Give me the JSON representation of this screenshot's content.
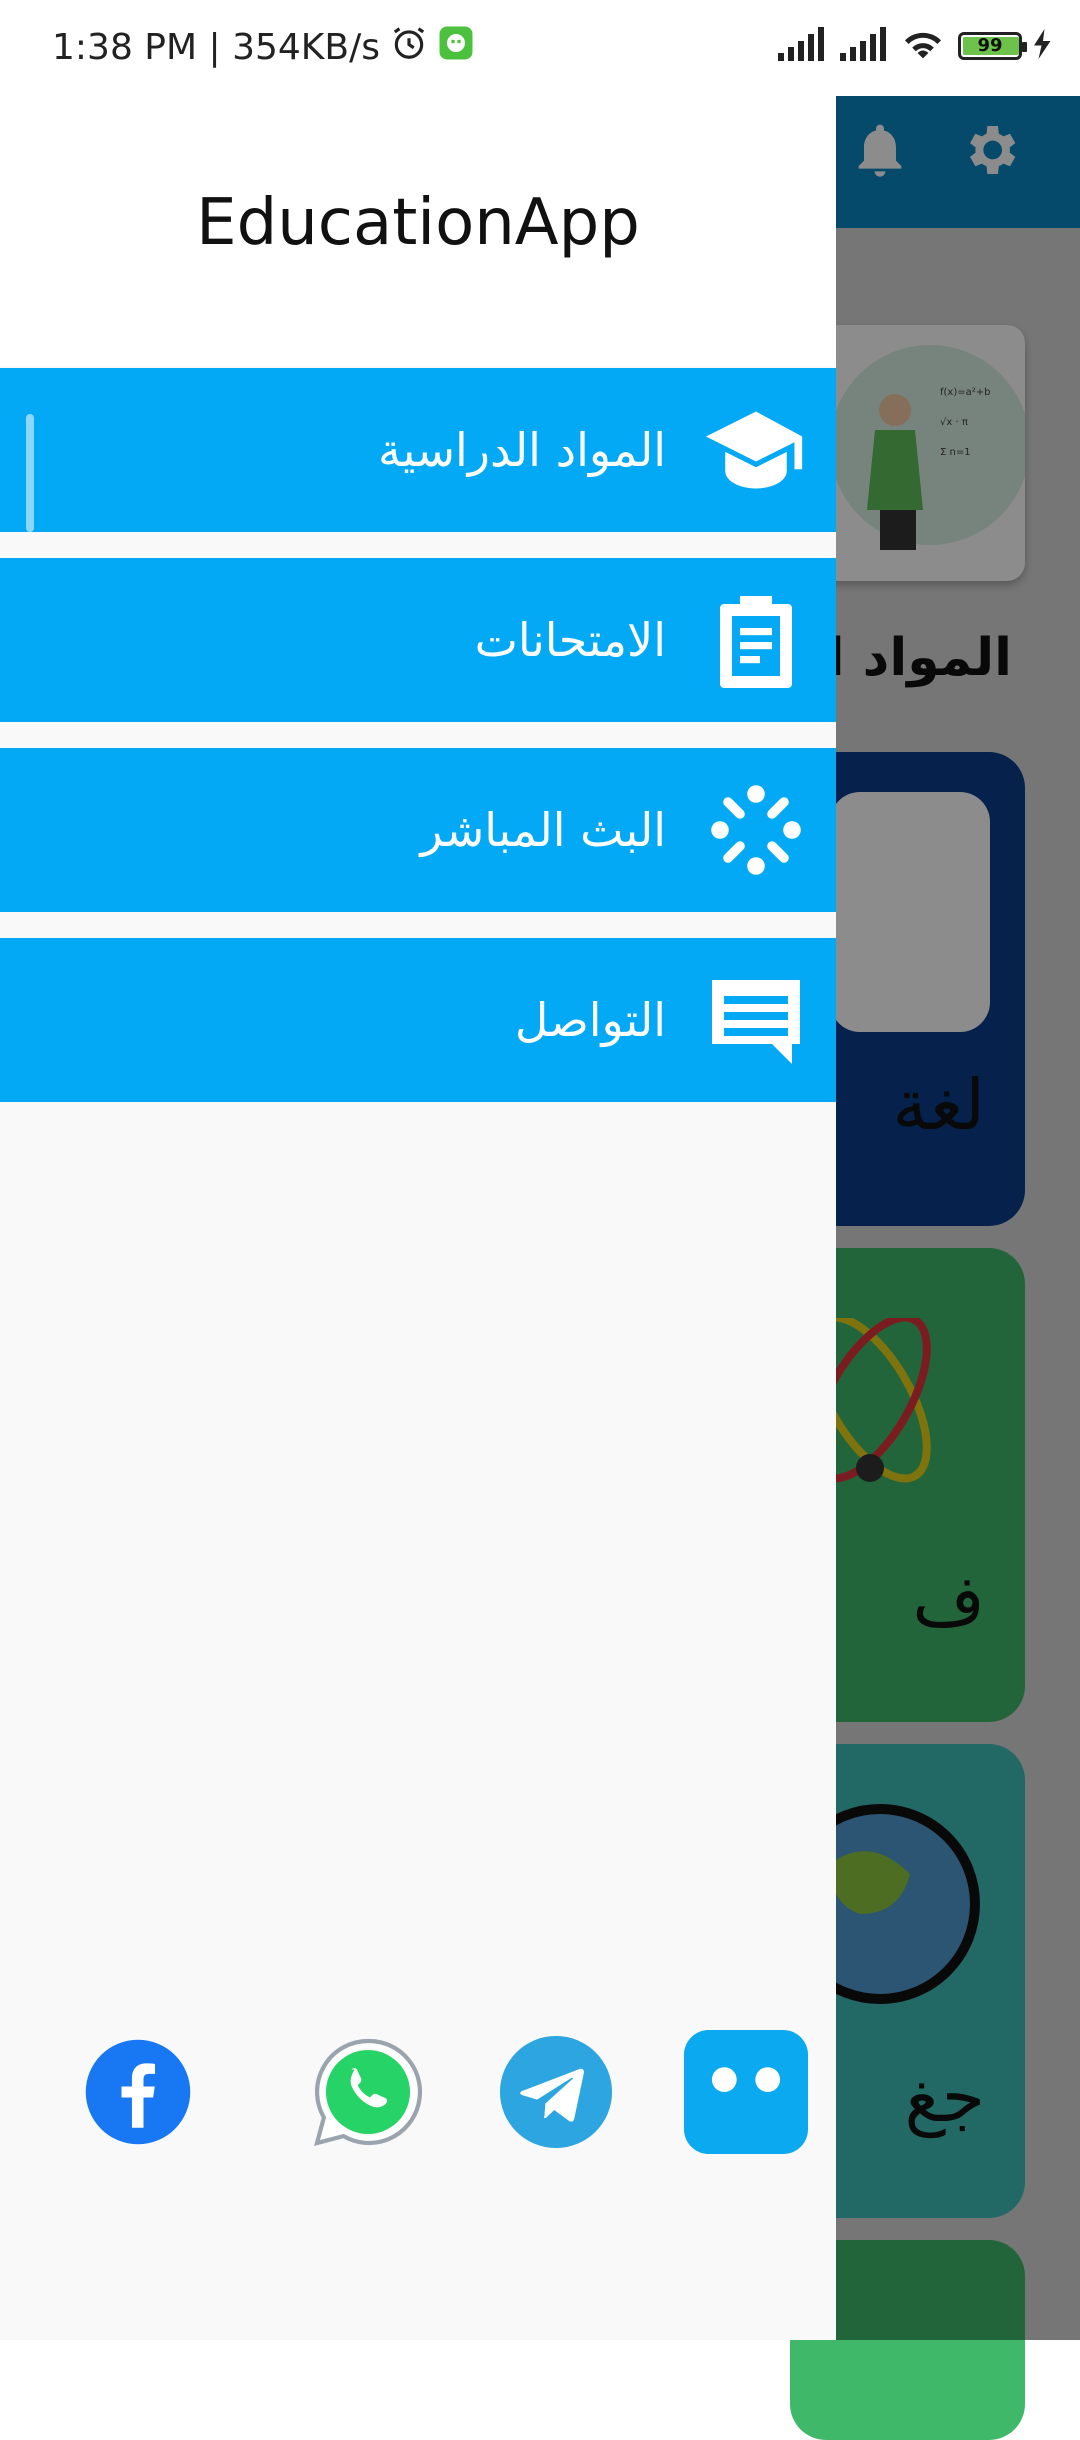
{
  "status_bar": {
    "time_speed": "1:38 PM | 354KB/s",
    "battery_level": "99"
  },
  "drawer": {
    "title": "EducationApp",
    "menu": [
      {
        "label": "المواد الدراسية",
        "icon": "graduation-cap-icon"
      },
      {
        "label": "الامتحانات",
        "icon": "clipboard-icon"
      },
      {
        "label": "البث المباشر",
        "icon": "live-broadcast-icon"
      },
      {
        "label": "التواصل",
        "icon": "chat-icon"
      }
    ],
    "social": [
      {
        "name": "facebook-icon",
        "color": "#1877f2"
      },
      {
        "name": "whatsapp-icon",
        "color": "#25d366"
      },
      {
        "name": "telegram-icon",
        "color": "#2ca5e0"
      },
      {
        "name": "chatbot-icon",
        "color": "#0aa9f0"
      }
    ]
  },
  "background": {
    "section_title": "المواد ا",
    "cards": [
      {
        "label": "لغة",
        "color": "#0a3c8a"
      },
      {
        "label": "ف",
        "color": "#3fb86a"
      },
      {
        "label": "جغ",
        "color": "#3fbfb8"
      }
    ],
    "accent": "#03a9f4"
  }
}
